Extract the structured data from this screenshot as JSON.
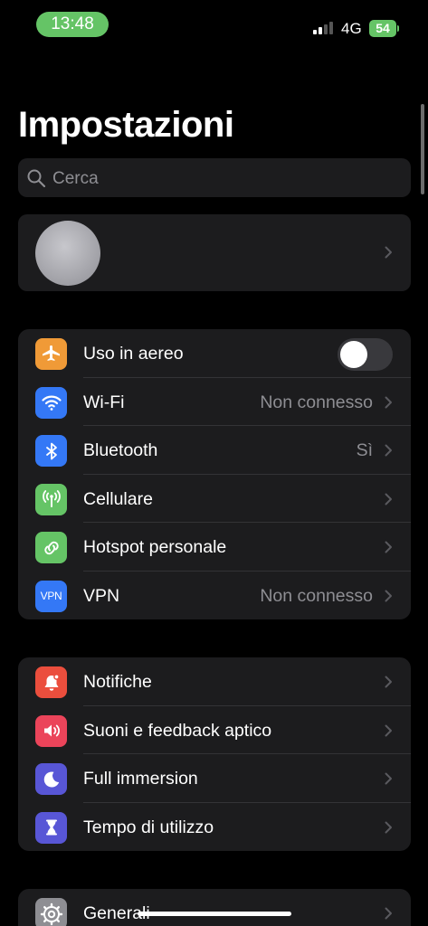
{
  "status_bar": {
    "time": "13:48",
    "network": "4G",
    "battery": "54"
  },
  "colors": {
    "airplane": "#f09a37",
    "wifi": "#3478f6",
    "bluetooth": "#3478f6",
    "cellular": "#65c466",
    "hotspot": "#65c466",
    "vpn": "#3478f6",
    "notifications": "#eb4e3d",
    "sounds": "#eb445a",
    "focus": "#5856d6",
    "screen_time": "#5856d6",
    "general": "#8e8e93"
  },
  "page": {
    "title": "Impostazioni"
  },
  "search": {
    "placeholder": "Cerca"
  },
  "connectivity": {
    "airplane_label": "Uso in aereo",
    "wifi_label": "Wi-Fi",
    "wifi_value": "Non connesso",
    "bluetooth_label": "Bluetooth",
    "bluetooth_value": "Sì",
    "cellular_label": "Cellulare",
    "hotspot_label": "Hotspot personale",
    "vpn_label": "VPN",
    "vpn_icon_text": "VPN",
    "vpn_value": "Non connesso"
  },
  "alerts": {
    "notifications_label": "Notifiche",
    "sounds_label": "Suoni e feedback aptico",
    "focus_label": "Full immersion",
    "screen_time_label": "Tempo di utilizzo"
  },
  "system": {
    "general_label": "Generali"
  }
}
